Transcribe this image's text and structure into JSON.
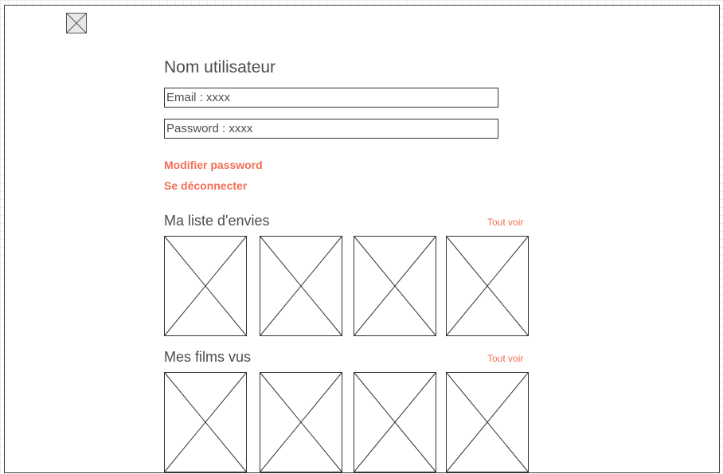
{
  "profile": {
    "username": "Nom utilisateur",
    "email": "Email : xxxx",
    "password": "Password : xxxx"
  },
  "actions": {
    "modify_password": "Modifier password",
    "logout": "Se déconnecter"
  },
  "sections": {
    "wishlist": {
      "title": "Ma liste d'envies",
      "see_all": "Tout voir"
    },
    "watched": {
      "title": "Mes films vus",
      "see_all": "Tout voir"
    }
  },
  "colors": {
    "accent": "#f36e55",
    "text": "#4d4d4d",
    "frame": "#3a3a3a"
  },
  "icons": {
    "logo": "image-placeholder-icon",
    "thumbnail": "image-placeholder-icon"
  }
}
